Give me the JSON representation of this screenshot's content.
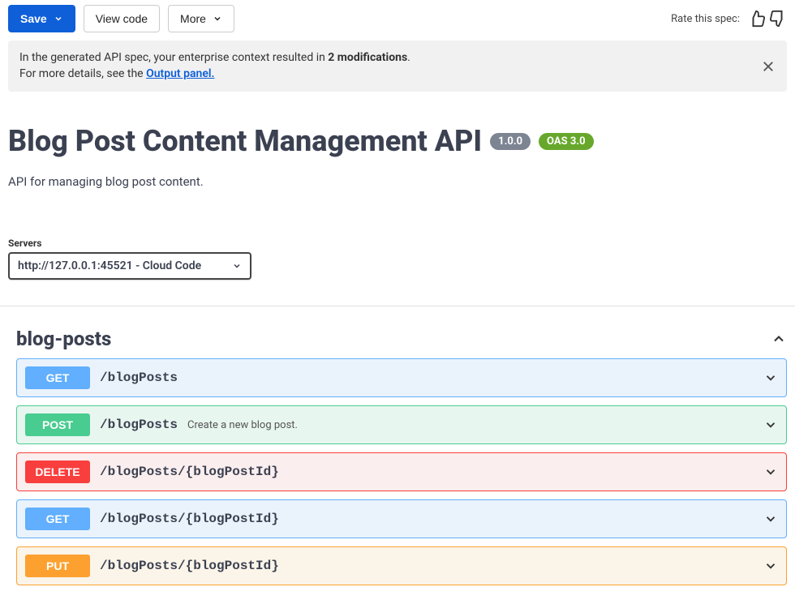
{
  "toolbar": {
    "save": "Save",
    "view_code": "View code",
    "more": "More"
  },
  "rate": {
    "label": "Rate this spec:"
  },
  "notice": {
    "prefix": "In the generated API spec, your enterprise context resulted in ",
    "bold": "2 modifications",
    "suffix": ".",
    "line2_prefix": "For more details, see the ",
    "link": "Output panel."
  },
  "api": {
    "title": "Blog Post Content Management API",
    "version": "1.0.0",
    "oas": "OAS 3.0",
    "description": "API for managing blog post content."
  },
  "servers": {
    "label": "Servers",
    "selected": "http://127.0.0.1:45521 - Cloud Code"
  },
  "tag": {
    "name": "blog-posts"
  },
  "ops": [
    {
      "method": "GET",
      "path": "/blogPosts",
      "summary": ""
    },
    {
      "method": "POST",
      "path": "/blogPosts",
      "summary": "Create a new blog post."
    },
    {
      "method": "DELETE",
      "path": "/blogPosts/{blogPostId}",
      "summary": ""
    },
    {
      "method": "GET",
      "path": "/blogPosts/{blogPostId}",
      "summary": ""
    },
    {
      "method": "PUT",
      "path": "/blogPosts/{blogPostId}",
      "summary": ""
    }
  ]
}
